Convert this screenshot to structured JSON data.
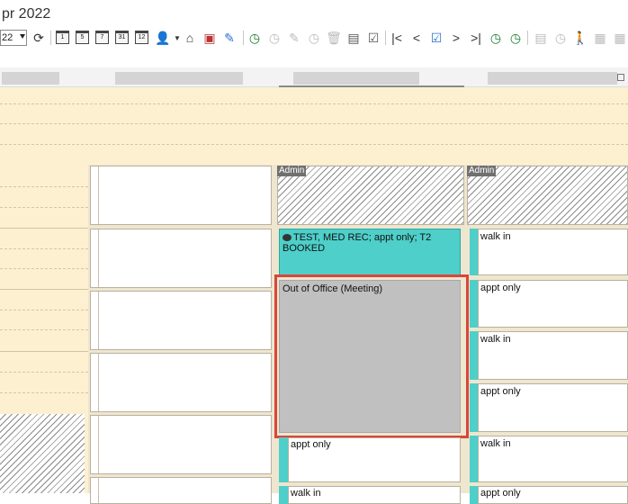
{
  "title": "pr 2022",
  "toolbar": {
    "combo_value": "22",
    "cal_labels": [
      "1",
      "5",
      "7",
      "31",
      "12"
    ]
  },
  "grid": {
    "admin_label": "Admin",
    "col3_appts": [
      {
        "text": "TEST, MED REC; appt only; T2 BOOKED"
      },
      {
        "text": "Out of Office (Meeting)"
      },
      {
        "text": "appt only"
      },
      {
        "text": "walk in"
      }
    ],
    "col4_appts": [
      {
        "text": "walk in"
      },
      {
        "text": "appt only"
      },
      {
        "text": "walk in"
      },
      {
        "text": "appt only"
      },
      {
        "text": "walk in"
      },
      {
        "text": "appt only"
      }
    ]
  },
  "colors": {
    "accent_teal": "#4ecfc9",
    "highlight_red": "#d9463b",
    "beige": "#fdf0d0"
  }
}
